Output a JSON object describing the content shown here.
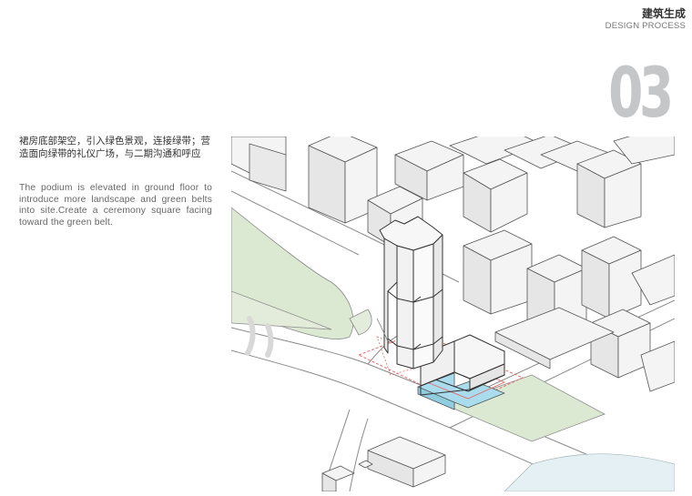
{
  "header": {
    "title_cn": "建筑生成",
    "title_en": "DESIGN PROCESS"
  },
  "step": {
    "number": "03"
  },
  "description": {
    "cn": "裙房底部架空，引入绿色景观，连接绿带；营造面向绿带的礼仪广场，与二期沟通和呼应",
    "en": "The podium is elevated in ground floor to introduce more landscape and green belts into site.Create a ceremony square facing toward the green belt."
  },
  "colors": {
    "green": "#dbe8d2",
    "blue": "#a9dced",
    "red_dash": "#e66a6a",
    "building": "#f4f4f4",
    "outline": "#555555"
  }
}
